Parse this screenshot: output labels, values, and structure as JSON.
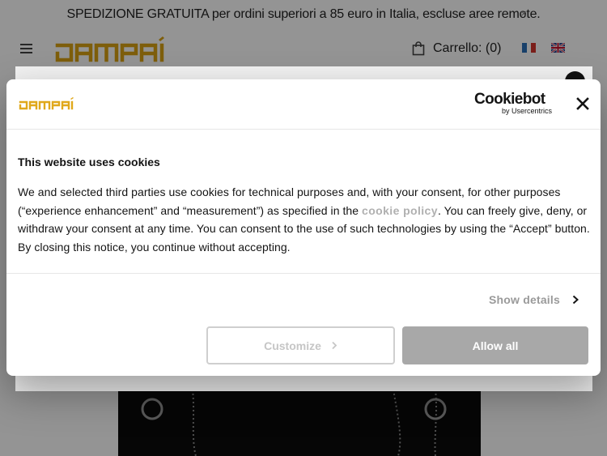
{
  "promo": {
    "text": "SPEDIZIONE GRATUITA per ordini superiori a 85 euro in Italia, escluse aree remote.",
    "close_glyph": "×"
  },
  "header": {
    "brand": "JAMPAÌ",
    "cart_label": "Carrello: (0)",
    "languages": [
      "it",
      "en"
    ]
  },
  "cookie_banner": {
    "brand": "JAMPAÌ",
    "provider_name": "Cookiebot",
    "provider_sub": "by Usercentrics",
    "title": "This website uses cookies",
    "text_before_link": "We and selected third parties use cookies for technical purposes and, with your consent, for other purposes (“experience enhancement” and “measurement”) as specified in the ",
    "link_text": "cookie policy",
    "text_after_link": ". You can freely give, deny, or withdraw your consent at any time. You can consent to the use of such technologies by using the “Accept” button. By closing this notice, you continue without accepting.",
    "show_details_label": "Show details",
    "customize_label": "Customize",
    "allow_all_label": "Allow all"
  },
  "colors": {
    "brand_gold": "#d9a314",
    "allow_button": "#a8a8a8",
    "link_muted": "#b0b0b0"
  },
  "icons": [
    "menu-icon",
    "cart-icon",
    "close-icon",
    "chevron-right-icon"
  ]
}
